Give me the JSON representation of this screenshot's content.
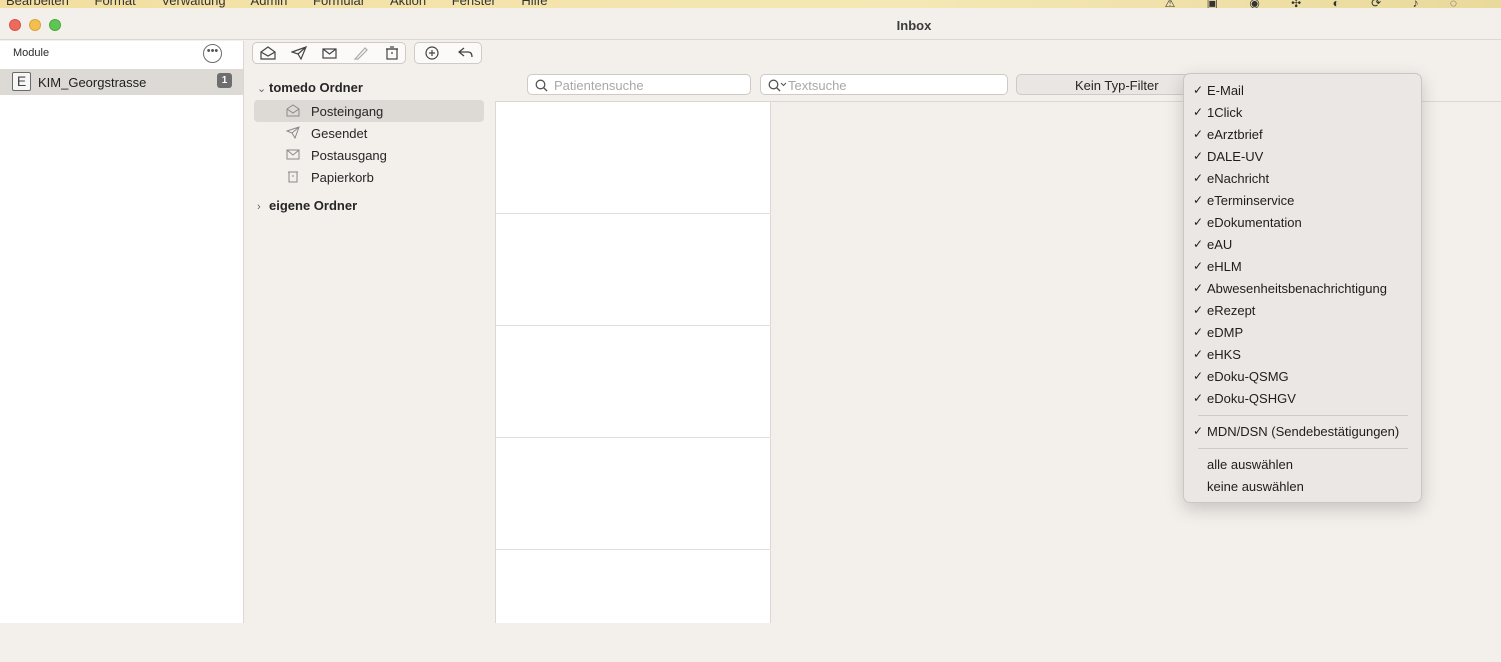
{
  "menubar": {
    "items": [
      "Bearbeiten",
      "Format",
      "Verwaltung",
      "Admin",
      "Formular",
      "Aktion",
      "Fenster",
      "Hilfe"
    ]
  },
  "window": {
    "title": "Inbox"
  },
  "sidebar": {
    "header": "Module",
    "module": {
      "initial": "E",
      "name": "KIM_Georgstrasse",
      "count": "1"
    }
  },
  "folders": {
    "group1": "tomedo Ordner",
    "items": [
      {
        "label": "Posteingang",
        "icon": "inbox-icon"
      },
      {
        "label": "Gesendet",
        "icon": "sent-icon"
      },
      {
        "label": "Postausgang",
        "icon": "outbox-icon"
      },
      {
        "label": "Papierkorb",
        "icon": "trash-icon"
      }
    ],
    "group2": "eigene Ordner"
  },
  "search": {
    "patient_placeholder": "Patientensuche",
    "text_placeholder": "Textsuche",
    "type_filter": "Kein Typ-Filter"
  },
  "type_menu": {
    "items": [
      {
        "label": "E-Mail",
        "checked": true
      },
      {
        "label": "1Click",
        "checked": true
      },
      {
        "label": "eArztbrief",
        "checked": true
      },
      {
        "label": "DALE-UV",
        "checked": true
      },
      {
        "label": "eNachricht",
        "checked": true
      },
      {
        "label": "eTerminservice",
        "checked": true
      },
      {
        "label": "eDokumentation",
        "checked": true
      },
      {
        "label": "eAU",
        "checked": true
      },
      {
        "label": "eHLM",
        "checked": true
      },
      {
        "label": "Abwesenheitsbenachrichtigung",
        "checked": true
      },
      {
        "label": "eRezept",
        "checked": true
      },
      {
        "label": "eDMP",
        "checked": true
      },
      {
        "label": "eHKS",
        "checked": true
      },
      {
        "label": "eDoku-QSMG",
        "checked": true
      },
      {
        "label": "eDoku-QSHGV",
        "checked": true
      }
    ],
    "mdn": "MDN/DSN (Sendebestätigungen)",
    "check": "✓",
    "select_all": "alle auswählen",
    "select_none": "keine auswählen"
  }
}
